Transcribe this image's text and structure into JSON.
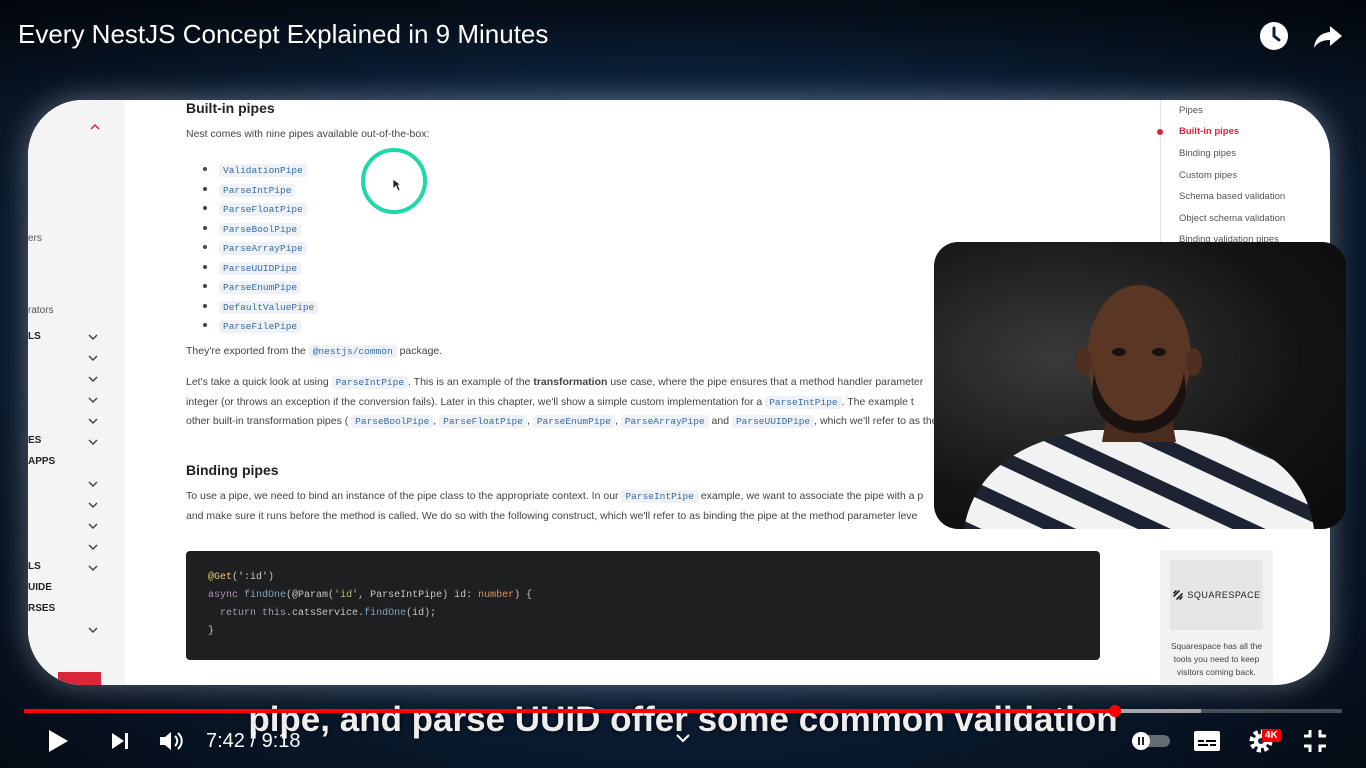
{
  "player": {
    "title": "Every NestJS Concept Explained in 9 Minutes",
    "current_time": "7:42",
    "duration": "9:18",
    "time_display": "7:42 / 9:18",
    "progress_fraction": 0.828,
    "buffered_fraction": 0.893,
    "quality_badge": "4K",
    "caption": "pipe, and parse UUID offer some common validation",
    "accent_color": "#ff0000"
  },
  "icons": {
    "watch_later": "clock-icon",
    "share": "share-icon",
    "play": "play-icon",
    "next": "next-icon",
    "volume": "volume-icon",
    "chevron": "chevron-down-icon",
    "autoplay": "autoplay-toggle-icon",
    "subtitles": "subtitles-icon",
    "settings": "gear-icon",
    "fullscreen_exit": "exit-fullscreen-icon"
  },
  "sidebar": {
    "labels": [
      "ers",
      "rators",
      "LS",
      "ES",
      "APPS",
      "LS",
      "UIDE",
      "RSES"
    ]
  },
  "docs": {
    "section_builtin": "Built-in pipes",
    "intro": "Nest comes with nine pipes available out-of-the-box:",
    "pipes": [
      "ValidationPipe",
      "ParseIntPipe",
      "ParseFloatPipe",
      "ParseBoolPipe",
      "ParseArrayPipe",
      "ParseUUIDPipe",
      "ParseEnumPipe",
      "DefaultValuePipe",
      "ParseFilePipe"
    ],
    "exported_pre": "They're exported from the",
    "exported_code": "@nestjs/common",
    "exported_post": "package.",
    "lookat_pre": "Let's take a quick look at using",
    "lookat_code": "ParseIntPipe",
    "lookat_mid": ". This is an example of the",
    "lookat_bold": "transformation",
    "lookat_post": "use case, where the pipe ensures that a method handler parameter",
    "line2_pre": "integer (or throws an exception if the conversion fails). Later in this chapter, we'll show a simple custom implementation for a",
    "line2_code": "ParseIntPipe",
    "line2_post": ". The example t",
    "line3_pre": "other built-in transformation pipes (",
    "line3_codes": [
      "ParseBoolPipe",
      "ParseFloatPipe",
      "ParseEnumPipe",
      "ParseArrayPipe"
    ],
    "line3_and": "and",
    "line3_last": "ParseUUIDPipe",
    "line3_post": ", which we'll refer to as the",
    "section_binding": "Binding pipes",
    "binding_pre": "To use a pipe, we need to bind an instance of the pipe class to the appropriate context. In our",
    "binding_code": "ParseIntPipe",
    "binding_post": "example, we want to associate the pipe with a p",
    "binding_line2": "and make sure it runs before the method is called. We do so with the following construct, which we'll refer to as binding the pipe at the method parameter leve",
    "code": {
      "l1_dec": "@Get",
      "l1_rest": "(':id')",
      "l2_kw": "async",
      "l2_fn": "findOne",
      "l2_rest1": "(@Param(",
      "l2_str": "'id'",
      "l2_rest2": ", ParseIntPipe) id: ",
      "l2_ty": "number",
      "l2_rest3": ") {",
      "l3_kw": "return",
      "l3_this": "this",
      "l3_rest": ".catsService.",
      "l3_fn": "findOne",
      "l3_end": "(id);",
      "l4": "}"
    }
  },
  "toc": {
    "items": [
      "Pipes",
      "Built-in pipes",
      "Binding pipes",
      "Custom pipes",
      "Schema based validation",
      "Object schema validation",
      "Binding validation pipes"
    ],
    "active_index": 1,
    "active_color": "#d9263b"
  },
  "ad": {
    "brand": "SQUARESPACE",
    "text": "Squarespace has all the tools you need to keep visitors coming back."
  }
}
